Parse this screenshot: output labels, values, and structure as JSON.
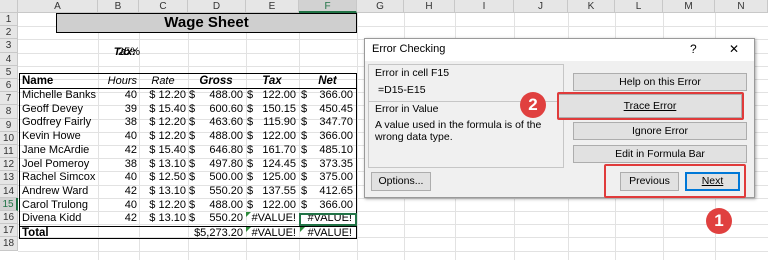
{
  "columns": [
    "A",
    "B",
    "C",
    "D",
    "E",
    "F",
    "G",
    "H",
    "I",
    "J",
    "K",
    "L",
    "M",
    "N"
  ],
  "rows": [
    "1",
    "2",
    "3",
    "4",
    "5",
    "6",
    "7",
    "8",
    "9",
    "10",
    "11",
    "12",
    "13",
    "14",
    "15",
    "16",
    "17",
    "18"
  ],
  "sheet": {
    "title": "Wage Sheet",
    "tax_label": "Tax:",
    "tax_value": "25%",
    "headers": {
      "name": "Name",
      "hours": "Hours",
      "rate": "Rate",
      "gross": "Gross",
      "tax": "Tax",
      "net": "Net"
    },
    "employees": [
      {
        "name": "Michelle Banks",
        "hours": "40",
        "rate": "$ 12.20",
        "gross": "488.00",
        "tax": "122.00",
        "net": "366.00"
      },
      {
        "name": "Geoff Devey",
        "hours": "39",
        "rate": "$ 15.40",
        "gross": "600.60",
        "tax": "150.15",
        "net": "450.45"
      },
      {
        "name": "Godfrey Fairly",
        "hours": "38",
        "rate": "$ 12.20",
        "gross": "463.60",
        "tax": "115.90",
        "net": "347.70"
      },
      {
        "name": "Kevin Howe",
        "hours": "40",
        "rate": "$ 12.20",
        "gross": "488.00",
        "tax": "122.00",
        "net": "366.00"
      },
      {
        "name": "Jane McArdie",
        "hours": "42",
        "rate": "$ 15.40",
        "gross": "646.80",
        "tax": "161.70",
        "net": "485.10"
      },
      {
        "name": "Joel Pomeroy",
        "hours": "38",
        "rate": "$ 13.10",
        "gross": "497.80",
        "tax": "124.45",
        "net": "373.35"
      },
      {
        "name": "Rachel Simcox",
        "hours": "40",
        "rate": "$ 12.50",
        "gross": "500.00",
        "tax": "125.00",
        "net": "375.00"
      },
      {
        "name": "Andrew Ward",
        "hours": "42",
        "rate": "$ 13.10",
        "gross": "550.20",
        "tax": "137.55",
        "net": "412.65"
      },
      {
        "name": "Carol Trulong",
        "hours": "40",
        "rate": "$ 12.20",
        "gross": "488.00",
        "tax": "122.00",
        "net": "366.00"
      },
      {
        "name": "Divena Kidd",
        "hours": "42",
        "rate": "$ 13.10",
        "gross": "550.20",
        "tax": "#VALUE!",
        "net": "#VALUE!"
      }
    ],
    "total": {
      "label": "Total",
      "gross": "$5,273.20",
      "tax": "#VALUE!",
      "net": "#VALUE!"
    },
    "currency_symbol": "$"
  },
  "dialog": {
    "title": "Error Checking",
    "help_glyph": "?",
    "close_glyph": "✕",
    "error_in_cell": "Error in cell F15",
    "formula": "=D15-E15",
    "error_type": "Error in Value",
    "description": "A value used in the formula is of the wrong data type.",
    "buttons": {
      "help": "Help on this Error",
      "trace": "Trace Error",
      "ignore": "Ignore Error",
      "edit": "Edit in Formula Bar",
      "options": "Options...",
      "previous": "Previous",
      "next": "Next"
    }
  },
  "callouts": {
    "one": "1",
    "two": "2"
  },
  "colors": {
    "highlight": "#e03b3b",
    "badge": "#e0403f",
    "excel_green": "#217346"
  }
}
